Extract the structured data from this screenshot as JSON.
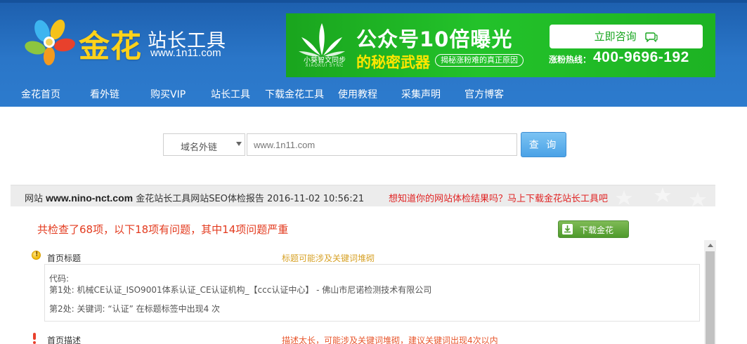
{
  "header": {
    "logo_title": "金花",
    "logo_subtitle": "站长工具",
    "logo_url": "www.1n11.com"
  },
  "ad": {
    "brand": "小葵智文同步",
    "brand_small": "XIAOKUI SYNC",
    "headline": "公众号10倍曝光",
    "slogan": "的秘密武器",
    "tag": "揭秘涨粉难的真正原因",
    "consult_button": "立即咨询",
    "hotline_label": "涨粉热线：",
    "hotline_number": "400-9696-192"
  },
  "nav": {
    "items": [
      {
        "label": "金花首页"
      },
      {
        "label": "看外链"
      },
      {
        "label": "购买VIP"
      },
      {
        "label": "站长工具"
      },
      {
        "label": "下载金花工具"
      },
      {
        "label": "使用教程"
      },
      {
        "label": "采集声明"
      },
      {
        "label": "官方博客"
      }
    ]
  },
  "search": {
    "select_value": "域名外链",
    "input_value": "www.1n11.com",
    "button_label": "查 询"
  },
  "report": {
    "title_prefix": "网站",
    "site": "www.nino-nct.com",
    "title_suffix": "金花站长工具网站SEO体检报告 2016-11-02 10:56:21",
    "promo": "想知道你的网站体检结果吗？马上下载金花站长工具吧",
    "summary": "共检查了68项，以下18项有问题，其中14项问题严重",
    "download_button": "下载金花",
    "items": [
      {
        "label": "首页标题",
        "note": "标题可能涉及关键词堆砌",
        "code_label": "代码:",
        "line1": "第1处: 机械CE认证_ISO9001体系认证_CE认证机构_【ccc认证中心】 - 佛山市尼诺检测技术有限公司",
        "line2": "第2处: 关键词: “认证” 在标题标签中出现4 次"
      },
      {
        "label": "首页描述",
        "note": "描述太长，可能涉及关键词堆砌，建议关键词出现4次以内"
      }
    ]
  },
  "colors": {
    "header_blue": "#2a76c8",
    "ad_green": "#1db323",
    "promo_red": "#e02424",
    "summary_red": "#e33b1f",
    "warning_note": "#d7a227",
    "error_note": "#e8562d"
  }
}
